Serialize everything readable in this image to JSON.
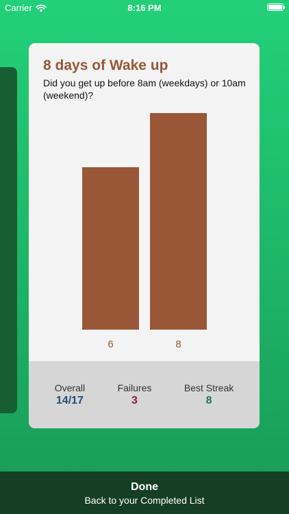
{
  "status_bar": {
    "carrier": "Carrier",
    "time": "8:16 PM"
  },
  "card": {
    "title": "8 days of Wake up",
    "question": "Did you get up before 8am (weekdays) or 10am (weekend)?"
  },
  "chart_data": {
    "type": "bar",
    "categories": [
      "6",
      "8"
    ],
    "values": [
      6,
      8
    ],
    "ylim": [
      0,
      8
    ],
    "color": "#995738",
    "grid": false
  },
  "stats": {
    "overall_label": "Overall",
    "overall_value": "14/17",
    "overall_color": "#1f4e79",
    "failures_label": "Failures",
    "failures_value": "3",
    "failures_color": "#8a1c32",
    "streak_label": "Best Streak",
    "streak_value": "8",
    "streak_color": "#1f7a45"
  },
  "done": {
    "title": "Done",
    "subtitle": "Back to your Completed List"
  }
}
